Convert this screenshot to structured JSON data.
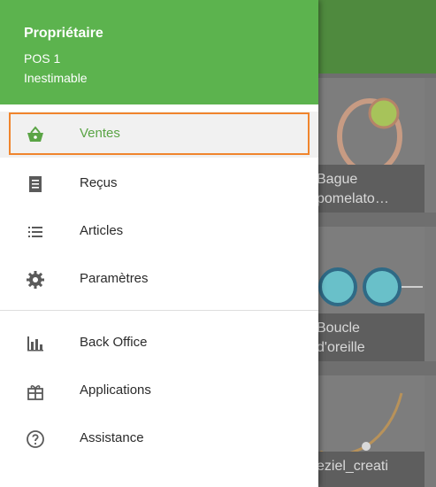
{
  "drawer": {
    "header": {
      "owner": "Propriétaire",
      "pos": "POS 1",
      "store": "Inestimable"
    },
    "items": [
      {
        "label": "Ventes",
        "icon": "basket-icon",
        "active": true
      },
      {
        "label": "Reçus",
        "icon": "receipt-icon",
        "active": false
      },
      {
        "label": "Articles",
        "icon": "list-icon",
        "active": false
      },
      {
        "label": "Paramètres",
        "icon": "gear-icon",
        "active": false
      },
      {
        "label": "Back Office",
        "icon": "bar-chart-icon",
        "active": false
      },
      {
        "label": "Applications",
        "icon": "gift-icon",
        "active": false
      },
      {
        "label": "Assistance",
        "icon": "help-circle-icon",
        "active": false
      }
    ]
  },
  "grid": {
    "tiles": [
      {
        "caption": "Bague\npomelato…"
      },
      {
        "caption": "Boucle\nd'oreille"
      },
      {
        "caption": "eziel_creati"
      }
    ]
  },
  "colors": {
    "drawer_header": "#5cb34e",
    "accent_green": "#5aa445",
    "highlight_orange": "#f0852d",
    "appbar": "#4f8a3e"
  }
}
